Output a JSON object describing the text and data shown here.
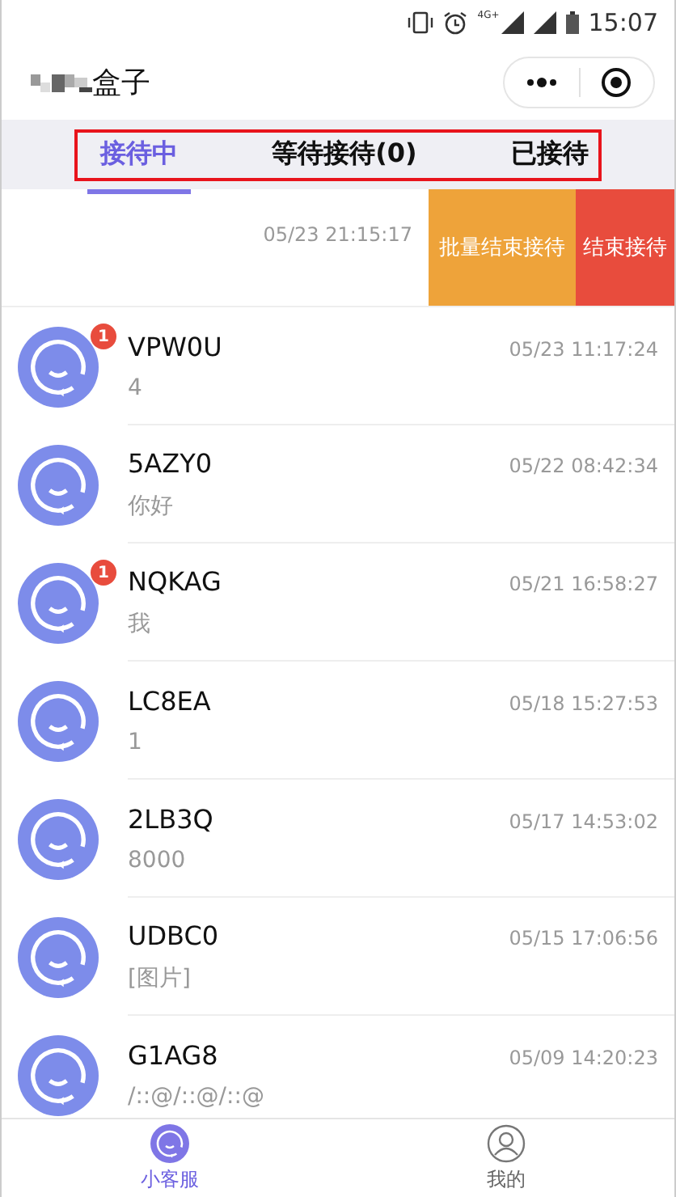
{
  "status_bar": {
    "network": "4G+",
    "time": "15:07"
  },
  "header": {
    "title": "盒子"
  },
  "tabs": [
    {
      "label": "接待中",
      "selected": true
    },
    {
      "label": "等待接待(0)",
      "selected": false
    },
    {
      "label": "已接待",
      "selected": false
    }
  ],
  "swiped_row": {
    "time": "05/23 21:15:17",
    "actions": [
      {
        "label": "批量结束接待",
        "kind": "batch"
      },
      {
        "label": "结束接待",
        "kind": "end"
      }
    ]
  },
  "conversations": [
    {
      "name": "VPW0U",
      "time": "05/23 11:17:24",
      "message": "4",
      "badge": "1"
    },
    {
      "name": "5AZY0",
      "time": "05/22 08:42:34",
      "message": "你好"
    },
    {
      "name": "NQKAG",
      "time": "05/21 16:58:27",
      "message": "我",
      "badge": "1"
    },
    {
      "name": "LC8EA",
      "time": "05/18 15:27:53",
      "message": "1"
    },
    {
      "name": "2LB3Q",
      "time": "05/17 14:53:02",
      "message": "8000"
    },
    {
      "name": "UDBC0",
      "time": "05/15 17:06:56",
      "message": "[图片]"
    },
    {
      "name": "G1AG8",
      "time": "05/09 14:20:23",
      "message": "/::@/::@/::@"
    }
  ],
  "bottom_nav": [
    {
      "label": "小客服",
      "kind": "service",
      "selected": true
    },
    {
      "label": "我的",
      "kind": "profile",
      "selected": false
    }
  ]
}
